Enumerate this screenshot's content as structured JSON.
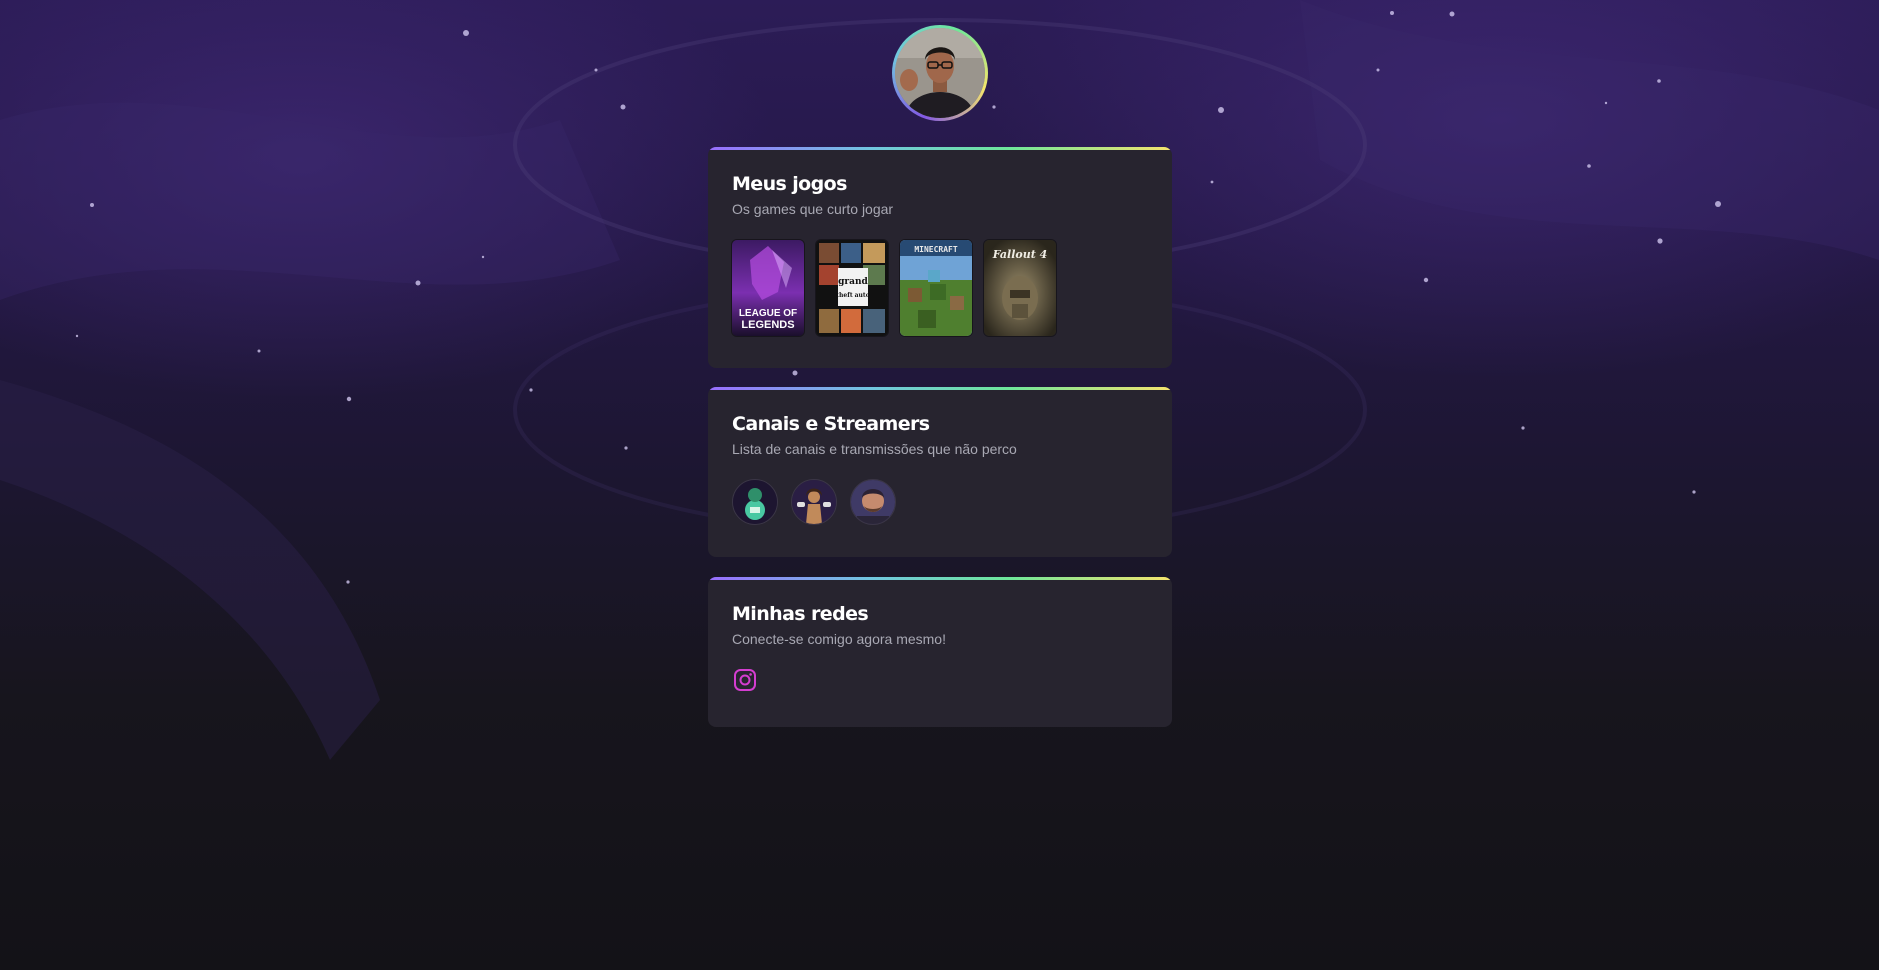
{
  "profile": {
    "avatar_icon": "profile-photo"
  },
  "games_section": {
    "title": "Meus jogos",
    "subtitle": "Os games que curto jogar",
    "games": [
      {
        "name": "League of Legends",
        "cover_text_1": "LEAGUE OF",
        "cover_text_2": "LEGENDS"
      },
      {
        "name": "Grand Theft Auto V",
        "cover_text_1": "grand",
        "cover_text_2": "theft auto"
      },
      {
        "name": "Minecraft",
        "cover_text_1": "MINECRAFT"
      },
      {
        "name": "Fallout 4",
        "cover_text_1": "Fallout 4"
      }
    ]
  },
  "streamers_section": {
    "title": "Canais e Streamers",
    "subtitle": "Lista de canais e transmissões que não perco",
    "streamers": [
      "streamer-1",
      "streamer-2",
      "streamer-3"
    ]
  },
  "socials_section": {
    "title": "Minhas redes",
    "subtitle": "Conecte-se comigo agora mesmo!",
    "links": [
      {
        "icon": "instagram-icon"
      }
    ]
  },
  "colors": {
    "accent_gradient": [
      "#996dff",
      "#71c6e0",
      "#6ee79a",
      "#f6e46d"
    ],
    "card_bg": "#27242f",
    "instagram": "#d43dd0"
  }
}
